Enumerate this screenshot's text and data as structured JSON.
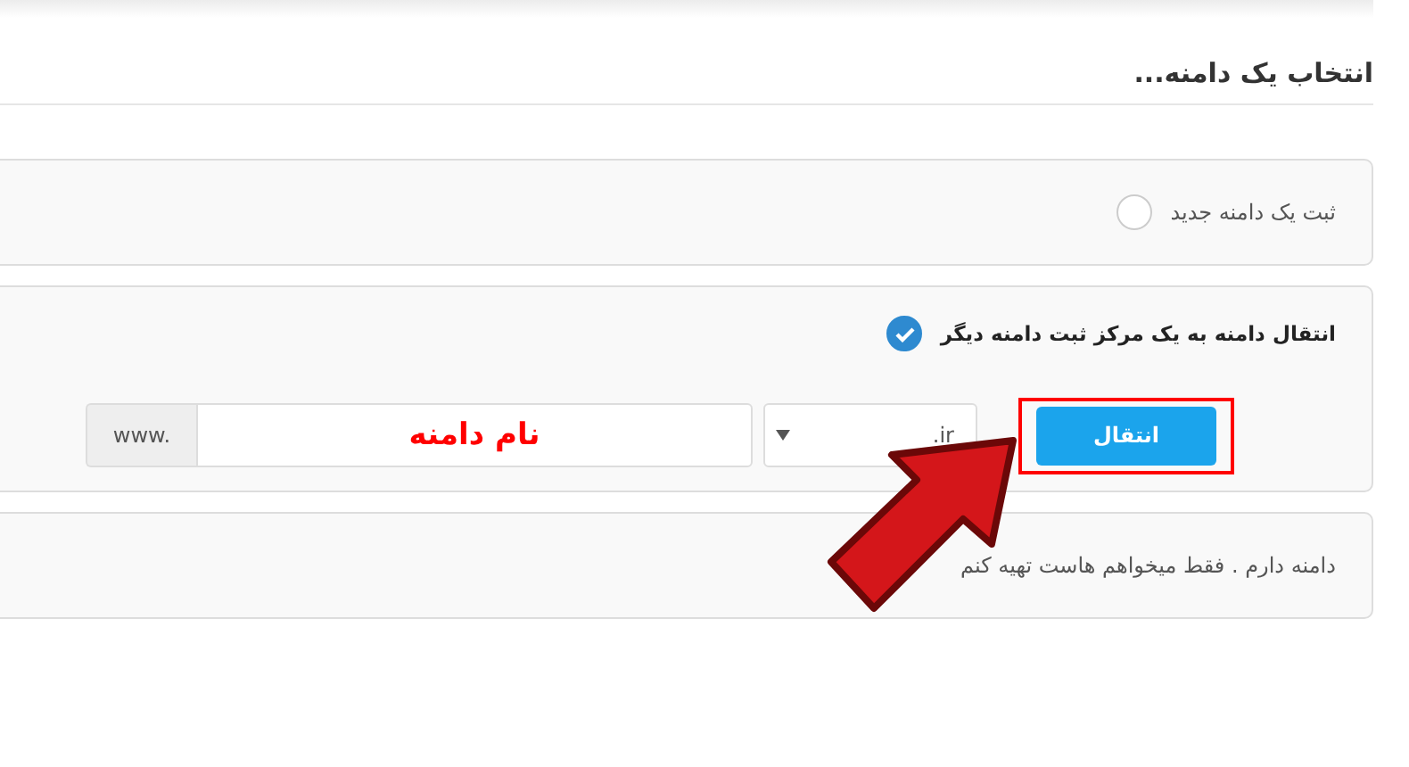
{
  "title": "انتخاب یک دامنه...",
  "options": [
    {
      "kind": "radio",
      "label": "ثبت یک دامنه جدید",
      "selected": false
    },
    {
      "kind": "radio",
      "label": "انتقال دامنه به یک مرکز ثبت دامنه دیگر",
      "selected": true,
      "transfer": {
        "button": "انتقال",
        "tld": ".ir",
        "prefix": "www.",
        "domain_value": "نام دامنه"
      }
    },
    {
      "kind": "text",
      "label": "دامنه دارم . فقط میخواهم هاست تهیه کنم"
    }
  ]
}
